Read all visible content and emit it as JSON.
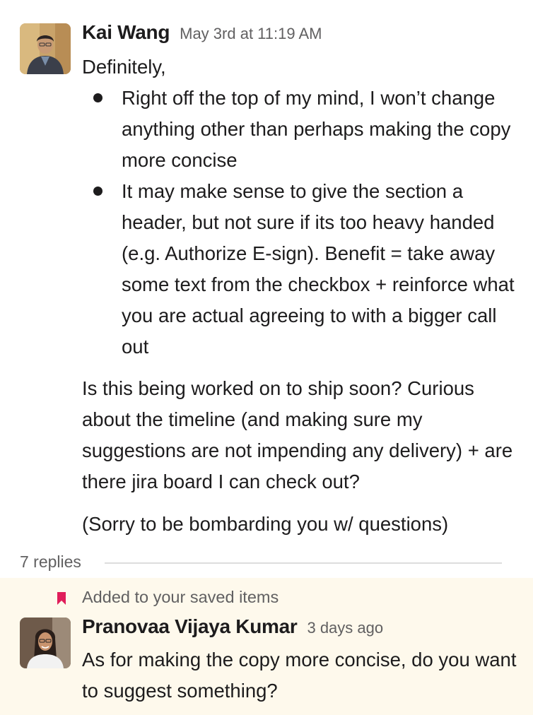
{
  "message1": {
    "sender": "Kai Wang",
    "timestamp": "May 3rd at 11:19 AM",
    "intro": "Definitely,",
    "bullets": [
      "Right off the top of my mind, I won’t change anything other than perhaps making the copy more concise",
      "It may make sense to give the section a header, but not sure if its too heavy handed (e.g. Authorize E-sign). Benefit = take away some text from the checkbox + reinforce what you are actual agreeing to with a bigger call out"
    ],
    "paragraphs": [
      "Is this being worked on to ship soon? Curious about the timeline (and making sure my suggestions are not impending any delivery) + are there jira board I can check out?",
      "(Sorry to be bombarding you w/ questions)"
    ]
  },
  "thread": {
    "replies_label": "7 replies"
  },
  "message2": {
    "saved_label": "Added to your saved items",
    "sender": "Pranovaa Vijaya Kumar",
    "timestamp": "3 days ago",
    "text": "As for making the copy more concise, do you want to suggest something?"
  },
  "icons": {
    "bookmark": "bookmark-icon"
  },
  "colors": {
    "saved_background": "#fef9ec",
    "bookmark": "#e01e5a",
    "muted_text": "#616061"
  }
}
